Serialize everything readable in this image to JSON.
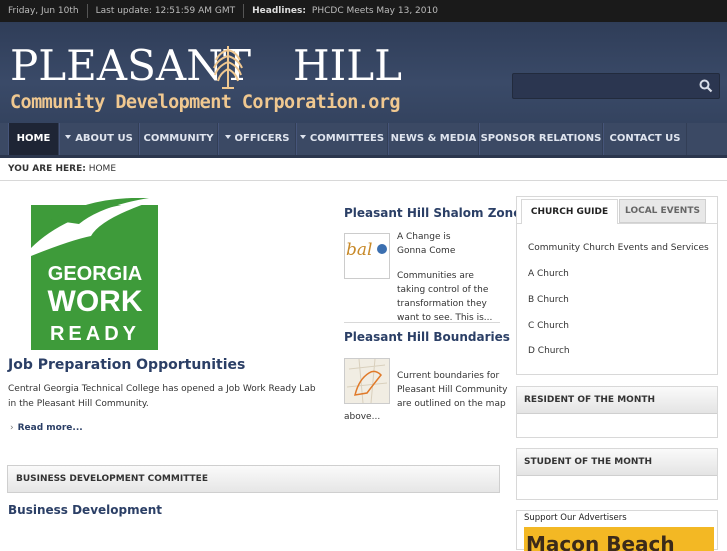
{
  "topbar": {
    "date": "Friday, Jun 10th",
    "last_update": "Last update: 12:51:59 AM GMT",
    "headlines_label": "Headlines:",
    "headline": "PHCDC Meets May 13, 2010"
  },
  "logo": {
    "line1_a": "PLEASANT",
    "line1_b": "HILL",
    "line2": "Community Development Corporation.org"
  },
  "search": {
    "placeholder": ""
  },
  "nav": {
    "items": [
      {
        "label": "HOME",
        "dropdown": false,
        "active": true
      },
      {
        "label": "ABOUT US",
        "dropdown": true
      },
      {
        "label": "COMMUNITY",
        "dropdown": false
      },
      {
        "label": "OFFICERS",
        "dropdown": true
      },
      {
        "label": "COMMITTEES",
        "dropdown": true
      },
      {
        "label": "NEWS & MEDIA",
        "dropdown": false
      },
      {
        "label": "SPONSOR RELATIONS",
        "dropdown": false
      },
      {
        "label": "CONTACT US",
        "dropdown": false
      }
    ]
  },
  "breadcrumb": {
    "label": "YOU ARE HERE:",
    "current": "HOME"
  },
  "feature": {
    "logo_text": [
      "GEORGIA",
      "WORK",
      "READY"
    ],
    "title": "Job Preparation Opportunities",
    "body": "Central Georgia Technical College has opened a Job Work Ready Lab in the Pleasant Hill Community.",
    "read_more": "Read more..."
  },
  "committee": {
    "header": "BUSINESS DEVELOPMENT COMMITTEE",
    "title": "Business Development"
  },
  "middle": {
    "shalom": {
      "title": "Pleasant Hill Shalom Zone",
      "thumb_text": "bal",
      "teaser": "A Change is Gonna Come",
      "body": "Communities are taking control of the transformation they want to see. This is..."
    },
    "boundaries": {
      "title": "Pleasant Hill Boundaries",
      "teaser_a": "Current boundaries for",
      "teaser_b": "Pleasant Hill Community",
      "teaser_c": "are outlined on the map",
      "teaser_d": "above..."
    }
  },
  "sidebar": {
    "tabs": {
      "church": "CHURCH GUIDE",
      "local": "LOCAL EVENTS"
    },
    "church_items": [
      "Community Church Events and Services",
      "A Church",
      "B Church",
      "C Church",
      "D Church"
    ],
    "resident_header": "RESIDENT OF THE MONTH",
    "student_header": "STUDENT OF THE MONTH",
    "ads_label": "Support Our Advertisers",
    "ad_text": "Macon Beach"
  },
  "colors": {
    "header_bg": "#3a4a68",
    "nav_bg": "#3b4964",
    "accent_title": "#2b3f66",
    "logo_green": "#3e9b3a",
    "logo_orange": "#f0c890"
  }
}
